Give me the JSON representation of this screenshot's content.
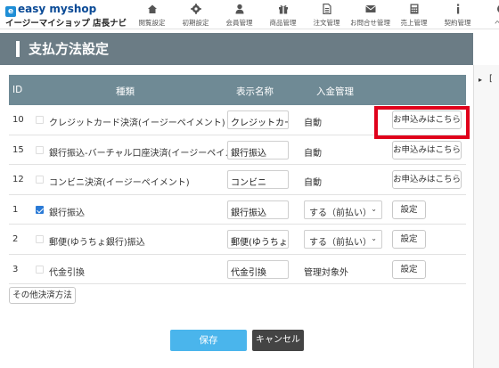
{
  "header": {
    "logo_main": "easy myshop",
    "logo_sub": "イージーマイショップ 店長ナビ",
    "nav": [
      {
        "label": "閲覧設定",
        "icon": "home-icon"
      },
      {
        "label": "初期設定",
        "icon": "gear-icon"
      },
      {
        "label": "会員管理",
        "icon": "person-icon"
      },
      {
        "label": "商品管理",
        "icon": "gift-icon"
      },
      {
        "label": "注文管理",
        "icon": "document-icon"
      },
      {
        "label": "お問合せ管理",
        "icon": "envelope-icon"
      },
      {
        "label": "売上管理",
        "icon": "calculator-icon"
      },
      {
        "label": "契約管理",
        "icon": "info-icon"
      },
      {
        "label": "ヘル",
        "icon": "help-icon"
      }
    ]
  },
  "page": {
    "title": "支払方法設定"
  },
  "table": {
    "headers": {
      "id": "ID",
      "type": "種類",
      "name": "表示名称",
      "mgmt": "入金管理"
    },
    "rows": [
      {
        "id": "10",
        "checked": false,
        "type": "クレジットカード決済(イージーペイメント)",
        "name": "クレジットカード",
        "mgmt": "自動",
        "action": "お申込みはこちら"
      },
      {
        "id": "15",
        "checked": false,
        "type": "銀行振込-バーチャル口座決済(イージーペイメント)",
        "name": "銀行振込",
        "mgmt": "自動",
        "action": "お申込みはこちら"
      },
      {
        "id": "12",
        "checked": false,
        "type": "コンビニ決済(イージーペイメント)",
        "name": "コンビニ",
        "mgmt": "自動",
        "action": "お申込みはこちら"
      },
      {
        "id": "1",
        "checked": true,
        "type": "銀行振込",
        "name": "銀行振込",
        "mgmt_select": "する（前払い）",
        "action": "設定"
      },
      {
        "id": "2",
        "checked": false,
        "type": "郵便(ゆうちょ銀行)振込",
        "name": "郵便(ゆうちょ銀",
        "mgmt_select": "する（前払い）",
        "action": "設定"
      },
      {
        "id": "3",
        "checked": false,
        "type": "代金引換",
        "name": "代金引換",
        "mgmt": "管理対象外",
        "action": "設定"
      }
    ]
  },
  "buttons": {
    "other": "その他決済方法",
    "save": "保存",
    "cancel": "キャンセル"
  },
  "right_panel": {
    "arrow": "▸",
    "bracket": "["
  },
  "colors": {
    "title_bar": "#6b7c85",
    "table_header": "#6f8a95",
    "save": "#4ab5ec",
    "cancel": "#444444",
    "highlight": "#e0001b"
  }
}
